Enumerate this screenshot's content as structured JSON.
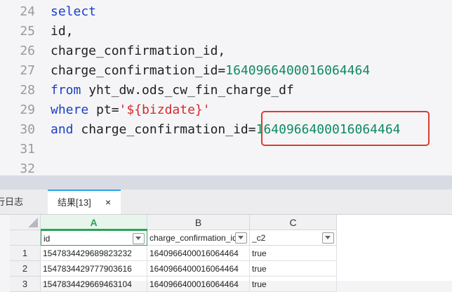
{
  "editor": {
    "lines": [
      {
        "n": "24",
        "tokens": [
          {
            "t": "select",
            "c": "kw"
          }
        ]
      },
      {
        "n": "25",
        "tokens": [
          {
            "t": "id,",
            "c": ""
          }
        ]
      },
      {
        "n": "26",
        "tokens": [
          {
            "t": "charge_confirmation_id,",
            "c": ""
          }
        ]
      },
      {
        "n": "27",
        "tokens": [
          {
            "t": "charge_confirmation_id",
            "c": ""
          },
          {
            "t": "=",
            "c": "op"
          },
          {
            "t": "1640966400016064464",
            "c": "num"
          }
        ]
      },
      {
        "n": "28",
        "tokens": [
          {
            "t": "from",
            "c": "kw"
          },
          {
            "t": " yht_dw.ods_cw_fin_charge_df",
            "c": ""
          }
        ]
      },
      {
        "n": "29",
        "tokens": [
          {
            "t": "where",
            "c": "kw"
          },
          {
            "t": " pt=",
            "c": ""
          },
          {
            "t": "'${bizdate}'",
            "c": "str"
          }
        ]
      },
      {
        "n": "30",
        "tokens": [
          {
            "t": "and",
            "c": "kw"
          },
          {
            "t": " charge_confirmation_id",
            "c": ""
          },
          {
            "t": "=",
            "c": "op"
          },
          {
            "t": "1640966400016064464",
            "c": "num"
          }
        ]
      },
      {
        "n": "31",
        "tokens": []
      },
      {
        "n": "32",
        "tokens": []
      }
    ]
  },
  "tabs": {
    "log_label": "行日志",
    "result_label": "结果[13]",
    "close_glyph": "×"
  },
  "grid": {
    "columns": [
      "A",
      "B",
      "C"
    ],
    "fields": [
      "id",
      "charge_confirmation_id",
      "_c2"
    ],
    "rows": [
      {
        "n": "1",
        "cells": [
          "1547834429689823232",
          "1640966400016064464",
          "true"
        ]
      },
      {
        "n": "2",
        "cells": [
          "1547834429777903616",
          "1640966400016064464",
          "true"
        ]
      },
      {
        "n": "3",
        "cells": [
          "1547834429669463104",
          "1640966400016064464",
          "true"
        ]
      }
    ]
  },
  "colors": {
    "keyword": "#1a3fc7",
    "number": "#0f8a5f",
    "string": "#d42a2a",
    "highlight": "#e03a2f",
    "accent": "#2aa8e8",
    "selected_col": "#2aa35a"
  }
}
